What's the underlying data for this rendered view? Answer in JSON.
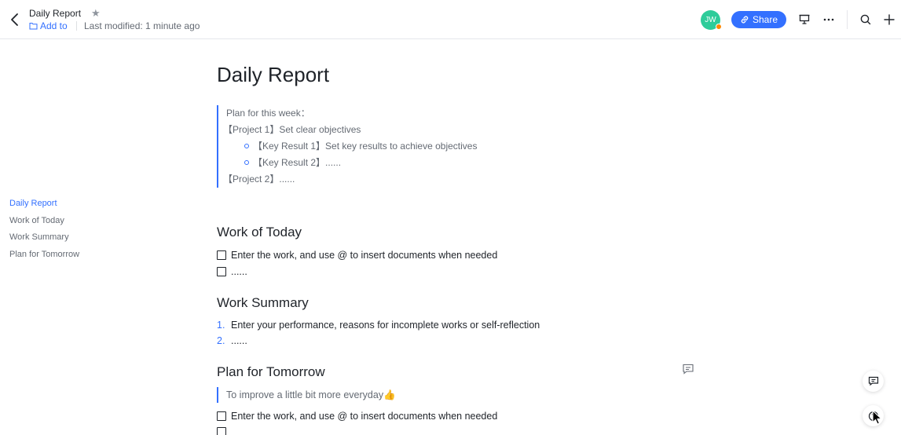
{
  "header": {
    "doc_title": "Daily Report",
    "add_to": "Add to",
    "last_modified": "Last modified: 1 minute ago",
    "avatar_initials": "JW",
    "share_label": "Share"
  },
  "outline": {
    "items": [
      {
        "label": "Daily Report",
        "active": true
      },
      {
        "label": "Work of Today",
        "active": false
      },
      {
        "label": "Work Summary",
        "active": false
      },
      {
        "label": "Plan for Tomorrow",
        "active": false
      }
    ]
  },
  "doc": {
    "title": "Daily Report",
    "plan_quote": {
      "line1": "Plan for this week：",
      "line2": "【Project 1】Set clear objectives",
      "line3": "【Key Result 1】Set key results to achieve objectives",
      "line4": "【Key Result 2】......",
      "line5": "【Project 2】......"
    },
    "work_today": {
      "heading": "Work of Today",
      "todo1": "Enter the work, and use @ to insert documents when needed",
      "todo2": "......"
    },
    "work_summary": {
      "heading": "Work Summary",
      "item1_num": "1.",
      "item1": "Enter your performance, reasons for incomplete works or self-reflection",
      "item2_num": "2.",
      "item2": "......"
    },
    "plan_tomorrow": {
      "heading": "Plan for Tomorrow",
      "quote": "To improve a little bit more everyday👍",
      "todo1": "Enter the work, and use @ to insert documents when needed"
    }
  },
  "colors": {
    "accent": "#3370ff",
    "avatar": "#2ecc9a",
    "status_dot": "#ff8800"
  },
  "icons": [
    "back-arrow-icon",
    "star-icon",
    "folder-icon",
    "link-icon",
    "presentation-icon",
    "more-icon",
    "search-icon",
    "plus-icon",
    "comment-icon",
    "help-icon",
    "cursor-icon"
  ]
}
